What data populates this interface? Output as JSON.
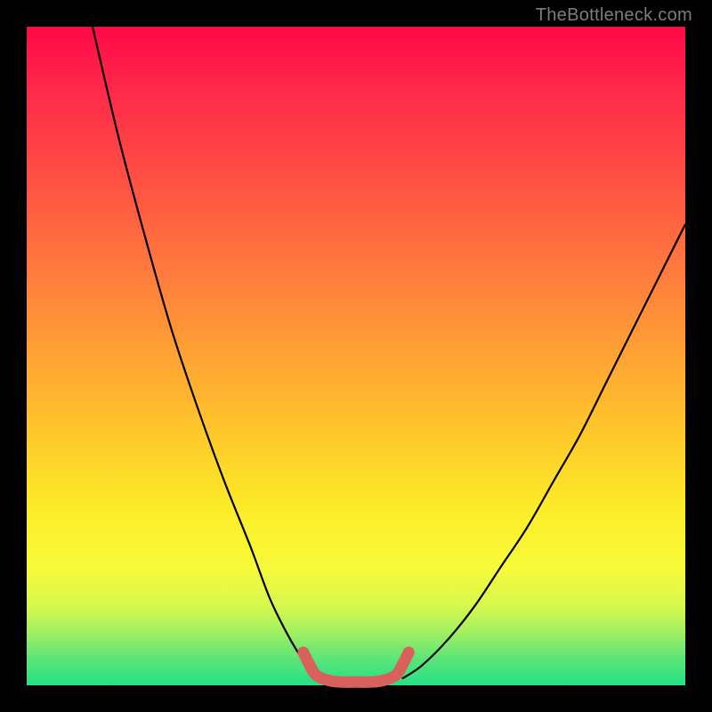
{
  "watermark": "TheBottleneck.com",
  "chart_data": {
    "type": "line",
    "title": "",
    "xlabel": "",
    "ylabel": "",
    "xlim": [
      0,
      100
    ],
    "ylim": [
      0,
      100
    ],
    "series": [
      {
        "name": "left-curve",
        "x": [
          10,
          14,
          18,
          22,
          26,
          30,
          34,
          37,
          40,
          42.5,
          44
        ],
        "values": [
          100,
          83,
          68,
          54,
          42,
          31,
          21,
          13,
          7,
          3,
          1
        ]
      },
      {
        "name": "right-curve",
        "x": [
          57,
          60,
          64,
          68,
          72,
          76,
          80,
          84,
          88,
          92,
          96,
          100
        ],
        "values": [
          1,
          3,
          7,
          12,
          18,
          24,
          31,
          38,
          46,
          54,
          62,
          70
        ]
      },
      {
        "name": "highlight-trough",
        "x": [
          42,
          43,
          44,
          46,
          48,
          50,
          52,
          54,
          56,
          57,
          58
        ],
        "values": [
          5,
          3,
          1.5,
          0.7,
          0.5,
          0.5,
          0.5,
          0.7,
          1.5,
          3,
          5
        ]
      }
    ],
    "colors": {
      "curve": "#000000",
      "highlight": "#d9605b"
    }
  }
}
